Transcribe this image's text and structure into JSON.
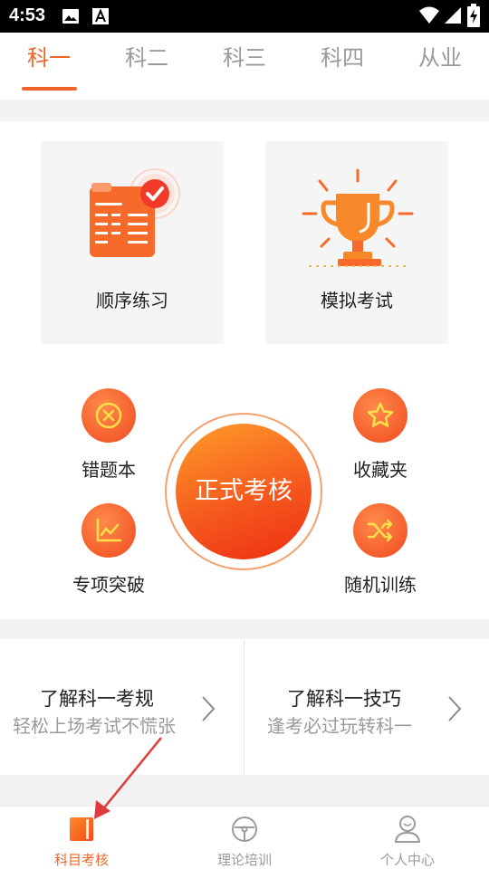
{
  "status_bar": {
    "time": "4:53",
    "icons": [
      "image-icon",
      "font-a-icon",
      "wifi-icon",
      "signal-icon",
      "battery-charging-icon"
    ]
  },
  "tabs": [
    {
      "label": "科一",
      "active": true
    },
    {
      "label": "科二",
      "active": false
    },
    {
      "label": "科三",
      "active": false
    },
    {
      "label": "科四",
      "active": false
    },
    {
      "label": "从业",
      "active": false
    }
  ],
  "cards": {
    "sequential": {
      "label": "顺序练习",
      "icon": "checklist-icon"
    },
    "mock": {
      "label": "模拟考试",
      "icon": "trophy-icon"
    }
  },
  "actions": {
    "wrong_book": {
      "label": "错题本",
      "icon": "close-circle-icon"
    },
    "favorites": {
      "label": "收藏夹",
      "icon": "star-icon"
    },
    "special": {
      "label": "专项突破",
      "icon": "chart-line-icon"
    },
    "random": {
      "label": "随机训练",
      "icon": "shuffle-icon"
    }
  },
  "exam_button": {
    "label": "正式考核"
  },
  "info": {
    "rules": {
      "title": "了解科一考规",
      "subtitle": "轻松上场考试不慌张"
    },
    "tips": {
      "title": "了解科一技巧",
      "subtitle": "逢考必过玩转科一"
    }
  },
  "bottom_nav": [
    {
      "label": "科目考核",
      "icon": "book-icon",
      "active": true
    },
    {
      "label": "理论培训",
      "icon": "steering-wheel-icon",
      "active": false
    },
    {
      "label": "个人中心",
      "icon": "person-icon",
      "active": false
    }
  ],
  "colors": {
    "accent": "#f0662a",
    "inactive_text": "#9a9a9a",
    "annotation_arrow": "#e03a3a"
  }
}
